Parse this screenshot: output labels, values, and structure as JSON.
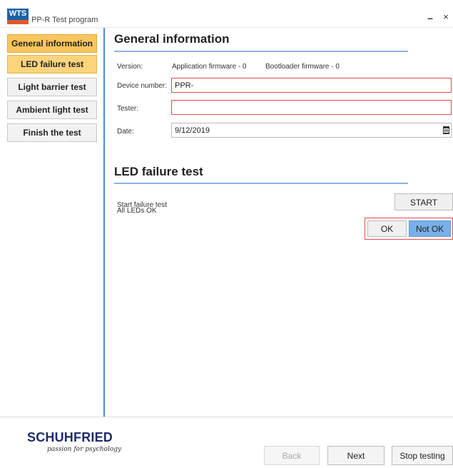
{
  "window": {
    "logo_text": "WTS",
    "title": "PP-R Test program",
    "minimize_glyph": "–",
    "close_glyph": "×"
  },
  "sidebar": {
    "items": [
      {
        "label": "General information",
        "state": "active"
      },
      {
        "label": "LED failure test",
        "state": "active"
      },
      {
        "label": "Light barrier test",
        "state": "inactive"
      },
      {
        "label": "Ambient light test",
        "state": "inactive"
      },
      {
        "label": "Finish the test",
        "state": "inactive"
      }
    ]
  },
  "general": {
    "title": "General information",
    "version_label": "Version:",
    "app_firmware": "Application firmware -  0",
    "bootloader_firmware": "Bootloader firmware -  0",
    "device_label": "Device number:",
    "device_value": "PPR-",
    "tester_label": "Tester:",
    "tester_value": "",
    "date_label": "Date:",
    "date_value": "9/12/2019"
  },
  "led": {
    "title": "LED failure test",
    "start_label": "Start failure test",
    "start_button": "START",
    "all_ok_label": "All LEDs OK",
    "ok_button": "OK",
    "not_ok_button": "Not OK"
  },
  "footer": {
    "brand": "SCHUHFRIED",
    "tagline": "passion for psychology",
    "back": "Back",
    "next": "Next",
    "stop": "Stop testing"
  },
  "colors": {
    "accent_orange": "#f9c65d",
    "accent_blue": "#78b0e8",
    "error_border": "#e04b4b",
    "brand_blue": "#1f2c6b"
  }
}
